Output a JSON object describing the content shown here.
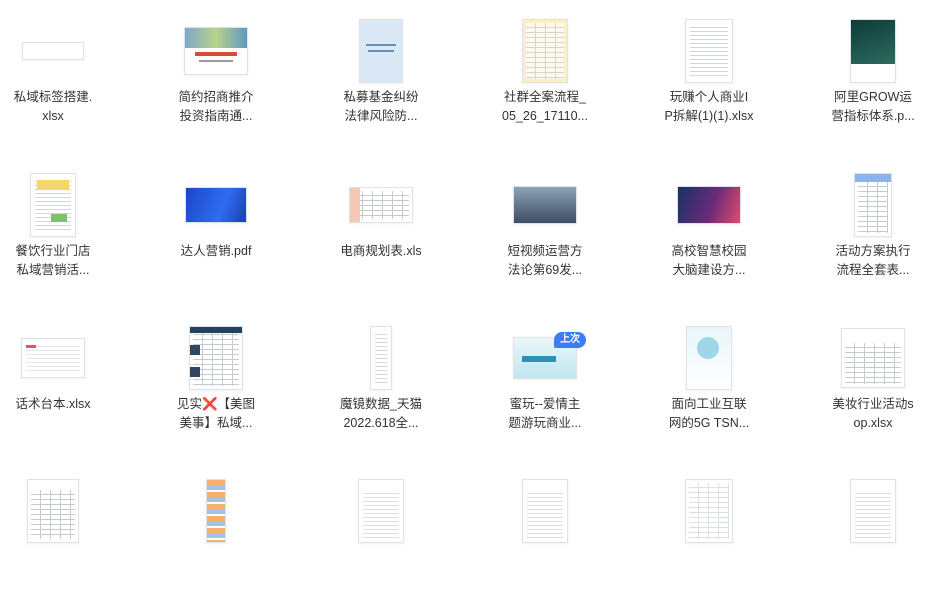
{
  "files": [
    {
      "name": "私域标签搭建.\nxlsx",
      "thumb": "blank"
    },
    {
      "name": "简约招商推介\n投资指南通...",
      "thumb": "brochure"
    },
    {
      "name": "私募基金纠纷\n法律风险防...",
      "thumb": "bluedoc"
    },
    {
      "name": "社群全案流程_\n05_26_17110...",
      "thumb": "yellowsheet"
    },
    {
      "name": "玩赚个人商业I\nP拆解(1)(1).xlsx",
      "thumb": "whitesheet"
    },
    {
      "name": "阿里GROW运\n营指标体系.p...",
      "thumb": "greendoc"
    },
    {
      "name": "餐饮行业门店\n私域营销活...",
      "thumb": "sheetyellow"
    },
    {
      "name": "达人营销.pdf",
      "thumb": "bluebanner"
    },
    {
      "name": "电商规划表.xls",
      "thumb": "widesheet"
    },
    {
      "name": "短视频运营方\n法论第69发...",
      "thumb": "cityslide"
    },
    {
      "name": "高校智慧校园\n大脑建设方...",
      "thumb": "colorslide"
    },
    {
      "name": "活动方案执行\n流程全套表...",
      "thumb": "bluesheet"
    },
    {
      "name": "话术台本.xlsx",
      "thumb": "smallsheet"
    },
    {
      "name": "见实❌【美图\n美事】私域...",
      "thumb": "darksheet"
    },
    {
      "name": "魔镜数据_天猫\n2022.618全...",
      "thumb": "narrowsheet"
    },
    {
      "name": "蜜玩--爱情主\n题游玩商业...",
      "thumb": "cyanslide",
      "badge": "上次"
    },
    {
      "name": "面向工业互联\n网的5G TSN...",
      "thumb": "techdoc"
    },
    {
      "name": "美妆行业活动s\nop.xlsx",
      "thumb": "tablesheet"
    },
    {
      "name": "",
      "thumb": "docform"
    },
    {
      "name": "",
      "thumb": "colorcol"
    },
    {
      "name": "",
      "thumb": "textdoc"
    },
    {
      "name": "",
      "thumb": "textdoc"
    },
    {
      "name": "",
      "thumb": "sheetlines"
    },
    {
      "name": "",
      "thumb": "textdoc"
    }
  ]
}
